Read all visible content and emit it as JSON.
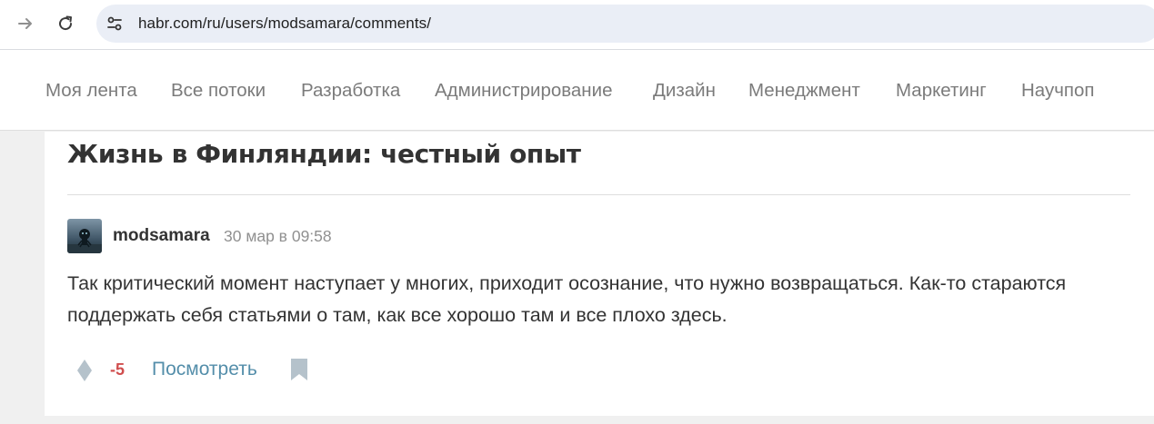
{
  "browser": {
    "url": "habr.com/ru/users/modsamara/comments/",
    "icons": {
      "back": "arrow-right-icon",
      "reload": "reload-icon",
      "site_info": "tune-icon"
    }
  },
  "nav": {
    "items": [
      {
        "label": "Моя лента"
      },
      {
        "label": "Все потоки"
      },
      {
        "label": "Разработка"
      },
      {
        "label": "Администрирование"
      },
      {
        "label": "Дизайн"
      },
      {
        "label": "Менеджмент"
      },
      {
        "label": "Маркетинг"
      },
      {
        "label": "Научпоп"
      }
    ]
  },
  "post": {
    "title": "Жизнь в Финляндии: честный опыт"
  },
  "comment": {
    "author": "modsamara",
    "timestamp": "30 мар в 09:58",
    "text": "Так критический момент наступает у многих, приходит осознание, что нужно возвращаться. Как-то стараются поддержать себя статьями о там, как все хорошо там и все плохо здесь.",
    "score": "-5",
    "view_label": "Посмотреть",
    "icons": {
      "vote": "vote-diamond-icon",
      "bookmark": "bookmark-icon"
    }
  },
  "colors": {
    "nav_text": "#7b7b7b",
    "score_negative": "#d04e4e",
    "link": "#548eaa",
    "icon_gray": "#b5c2cb"
  }
}
